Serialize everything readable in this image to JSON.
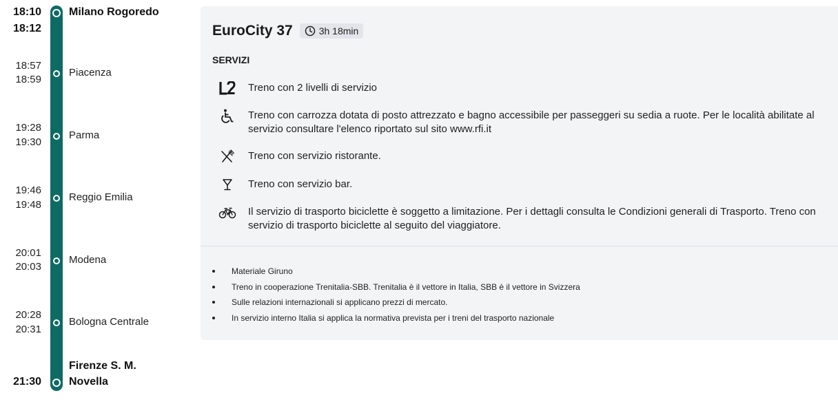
{
  "stops": [
    {
      "times": [
        "18:10",
        "18:12"
      ],
      "name": "Milano Rogoredo",
      "bold": true
    },
    {
      "times": [
        "18:57",
        "18:59"
      ],
      "name": "Piacenza",
      "bold": false
    },
    {
      "times": [
        "19:28",
        "19:30"
      ],
      "name": "Parma",
      "bold": false
    },
    {
      "times": [
        "19:46",
        "19:48"
      ],
      "name": "Reggio Emilia",
      "bold": false
    },
    {
      "times": [
        "20:01",
        "20:03"
      ],
      "name": "Modena",
      "bold": false
    },
    {
      "times": [
        "20:28",
        "20:31"
      ],
      "name": "Bologna Centrale",
      "bold": false
    },
    {
      "times": [
        "21:30"
      ],
      "name_lines": [
        "Firenze S. M.",
        "Novella"
      ],
      "bold": true
    }
  ],
  "details": {
    "train_name": "EuroCity 37",
    "duration": "3h 18min",
    "services_title": "SERVIZI",
    "services": [
      {
        "icon": "l2-level-icon",
        "text": "Treno con 2 livelli di servizio"
      },
      {
        "icon": "wheelchair-icon",
        "text": "Treno con carrozza dotata di posto attrezzato e bagno accessibile per passeggeri su sedia a ruote. Per le località abilitate al servizio consultare l'elenco riportato sul sito www.rfi.it"
      },
      {
        "icon": "restaurant-icon",
        "text": "Treno con servizio ristorante."
      },
      {
        "icon": "bar-glass-icon",
        "text": "Treno con servizio bar."
      },
      {
        "icon": "bicycle-icon",
        "text": "Il servizio di trasporto biciclette è soggetto a limitazione. Per i dettagli consulta le Condizioni generali di Trasporto. Treno con servizio di trasporto biciclette al seguito del viaggiatore."
      }
    ],
    "notes": [
      "Materiale Giruno",
      "Treno in cooperazione Trenitalia-SBB. Trenitalia è il vettore in Italia, SBB è il vettore in Svizzera",
      "Sulle relazioni internazionali si applicano prezzi di mercato.",
      "In servizio interno Italia si applica la normativa prevista per i treni del trasporto nazionale"
    ]
  },
  "colors": {
    "track": "#0e6b63",
    "panel": "#f3f4f6",
    "badge": "#e2e5ea"
  }
}
